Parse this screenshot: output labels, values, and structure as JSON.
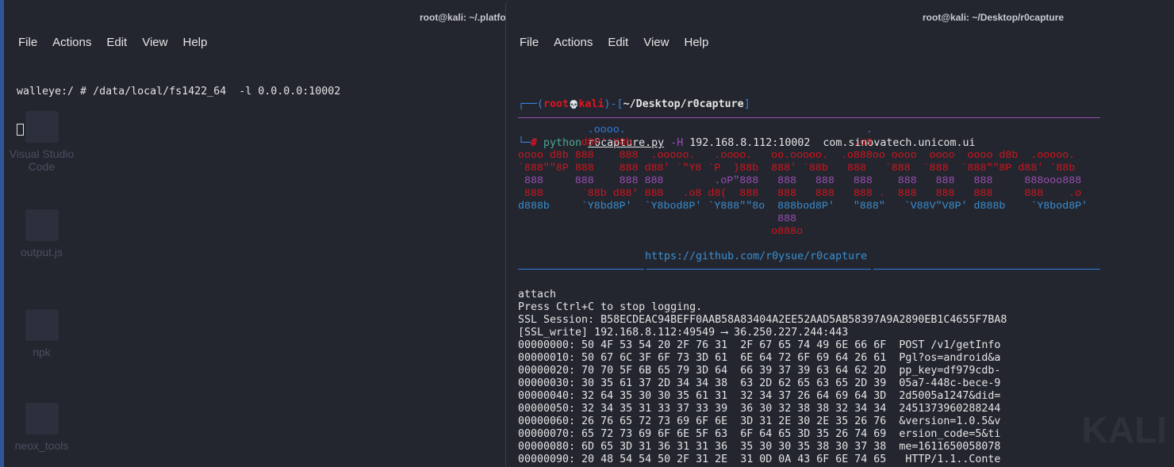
{
  "desktop": {
    "icons": [
      {
        "label": "Visual Studio Code"
      },
      {
        "label": "output.js"
      },
      {
        "label": "npk"
      },
      {
        "label": "neox_tools"
      }
    ],
    "watermark": "KALI"
  },
  "left_window": {
    "title": "root@kali: ~/.platform-tools",
    "menu": [
      "File",
      "Actions",
      "Edit",
      "View",
      "Help"
    ],
    "command_line": "walleye:/ # /data/local/fs1422_64  -l 0.0.0.0:10002"
  },
  "right_window": {
    "title": "root@kali: ~/Desktop/r0capture",
    "menu": [
      "File",
      "Actions",
      "Edit",
      "View",
      "Help"
    ],
    "prompt": {
      "user": "root",
      "skull": "💀",
      "host": "kali",
      "cwd": "~/Desktop/r0capture",
      "hash": "#",
      "cmd": "python",
      "script": "r0capture.py",
      "flag": "-H",
      "args": "192.168.8.112:10002  com.sinovatech.unicom.ui"
    },
    "banner": [
      "           .oooo.                                      .",
      "          d8P'`Y8b                                   .o8",
      "oooo d8b 888    888  .ooooo.   .oooo.   oo.ooooo.  .o888oo oooo  oooo  oooo d8b  .ooooo.",
      "`888\"\"8P 888    888 d88' `\"Y8 `P  )88b  888' `88b   888   `888  `888  `888\"\"8P d88' `88b",
      " 888     888    888 888        .oP\"888   888   888   888    888   888   888     888ooo888",
      " 888      `88b d88' 888   .o8 d8(  888   888   888   888 .  888   888   888     888    .o",
      "d888b     `Y8bd8P'  `Y8bod8P' `Y888\"\"8o  888bod8P'   \"888\"   `V88V\"V8P' d888b    `Y8bod8P'",
      "                                         888",
      "                                        o888o"
    ],
    "link": "https://github.com/r0ysue/r0capture",
    "output": [
      "attach",
      "Press Ctrl+C to stop logging.",
      "SSL Session: B58ECDEAC94BEFF0AAB58A83404A2EE52AAD5AB58397A9A2890EB1C4655F7BA8",
      "[SSL_write] 192.168.8.112:49549 ⟶ 36.250.227.244:443",
      "00000000: 50 4F 53 54 20 2F 76 31  2F 67 65 74 49 6E 66 6F  POST /v1/getInfo",
      "00000010: 50 67 6C 3F 6F 73 3D 61  6E 64 72 6F 69 64 26 61  Pgl?os=android&a",
      "00000020: 70 70 5F 6B 65 79 3D 64  66 39 37 39 63 64 62 2D  pp_key=df979cdb-",
      "00000030: 30 35 61 37 2D 34 34 38  63 2D 62 65 63 65 2D 39  05a7-448c-bece-9",
      "00000040: 32 64 35 30 30 35 61 31  32 34 37 26 64 69 64 3D  2d5005a1247&did=",
      "00000050: 32 34 35 31 33 37 33 39  36 30 32 38 38 32 34 34  2451373960288244",
      "00000060: 26 76 65 72 73 69 6F 6E  3D 31 2E 30 2E 35 26 76  &version=1.0.5&v",
      "00000070: 65 72 73 69 6F 6E 5F 63  6F 64 65 3D 35 26 74 69  ersion_code=5&ti",
      "00000080: 6D 65 3D 31 36 31 31 36  35 30 30 35 38 30 37 38  me=1611650058078",
      "00000090: 20 48 54 54 50 2F 31 2E  31 0D 0A 43 6F 6E 74 65   HTTP/1.1..Conte"
    ]
  },
  "colors": {
    "red": "#d4141c",
    "blue": "#2f7ee0",
    "purple": "#9b4fb3",
    "cyan": "#3a8fd0",
    "bg": "#23262f"
  }
}
